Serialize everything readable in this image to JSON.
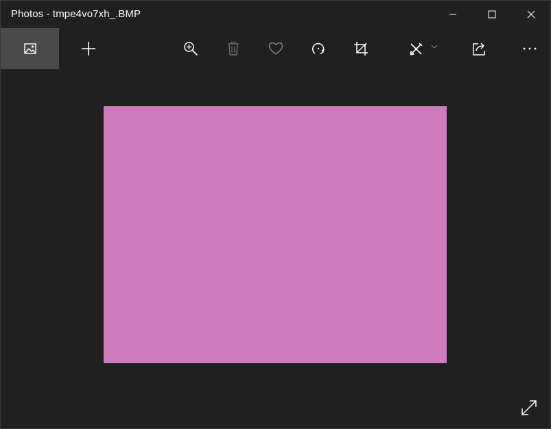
{
  "window": {
    "title": "Photos - tmpe4vo7xh_.BMP"
  },
  "titlebar": {
    "minimize_icon": "minimize-icon",
    "maximize_icon": "maximize-icon",
    "close_icon": "close-icon"
  },
  "toolbar": {
    "buttons": [
      {
        "name": "gallery",
        "icon": "image-icon"
      },
      {
        "name": "add",
        "icon": "plus-icon"
      },
      {
        "name": "zoom",
        "icon": "zoom-in-icon"
      },
      {
        "name": "delete",
        "icon": "trash-icon"
      },
      {
        "name": "favorite",
        "icon": "heart-icon"
      },
      {
        "name": "rotate",
        "icon": "rotate-icon"
      },
      {
        "name": "crop",
        "icon": "crop-icon"
      },
      {
        "name": "edit",
        "icon": "edit-create-icon"
      },
      {
        "name": "share",
        "icon": "share-icon"
      },
      {
        "name": "more",
        "icon": "more-icon"
      }
    ]
  },
  "image": {
    "fill_color": "#d07bbf"
  },
  "colors": {
    "background": "#202020",
    "active_button": "#4a4a4a",
    "icon": "#ffffff",
    "icon_disabled": "#6f6f6f"
  }
}
